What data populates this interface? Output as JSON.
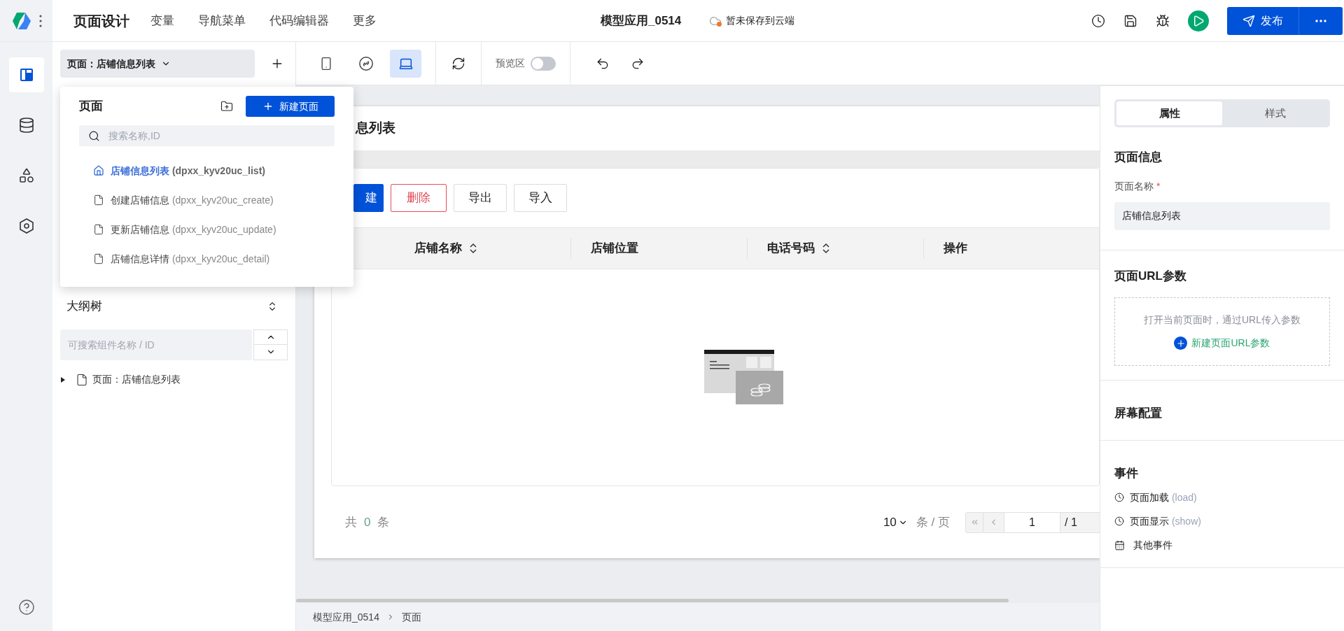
{
  "top_nav": {
    "title": "页面设计",
    "menu": [
      {
        "label": "变量"
      },
      {
        "label": "导航菜单"
      },
      {
        "label": "代码编辑器"
      },
      {
        "label": "更多"
      }
    ]
  },
  "app_title": "模型应用_0514",
  "save_status": "暂未保存到云端",
  "publish_button": "发布",
  "rail": [
    {
      "kind": "layout",
      "selected": true
    },
    {
      "kind": "database",
      "selected": false
    },
    {
      "kind": "components",
      "selected": false
    },
    {
      "kind": "settings",
      "selected": false
    }
  ],
  "page_selector": {
    "label": "页面：店铺信息列表"
  },
  "toolbar": {
    "devices": [
      {
        "kind": "phone",
        "selected": false
      },
      {
        "kind": "link",
        "selected": false
      },
      {
        "kind": "laptop",
        "selected": true
      }
    ],
    "preview": {
      "label": "预览区",
      "on": false
    }
  },
  "pages_dropdown": {
    "title": "页面",
    "new_button": "新建页面",
    "search_placeholder": "搜索名称,ID",
    "pages": [
      {
        "name": "店铺信息列表",
        "id": "(dpxx_kyv20uc_list)",
        "home": true,
        "selected": true
      },
      {
        "name": "创建店铺信息",
        "id": "(dpxx_kyv20uc_create)",
        "home": false,
        "selected": false
      },
      {
        "name": "更新店铺信息",
        "id": "(dpxx_kyv20uc_update)",
        "home": false,
        "selected": false
      },
      {
        "name": "店铺信息详情",
        "id": "(dpxx_kyv20uc_detail)",
        "home": false,
        "selected": false
      }
    ]
  },
  "outline": {
    "title": "大纲树",
    "search_placeholder": "可搜索组件名称 / ID",
    "tree": [
      {
        "label": "页面：店铺信息列表",
        "expanded": false
      }
    ]
  },
  "canvas": {
    "title": "息列表",
    "actions": [
      {
        "label": "建",
        "kind": "primary"
      },
      {
        "label": "删除",
        "kind": "danger"
      },
      {
        "label": "导出",
        "kind": "default"
      },
      {
        "label": "导入",
        "kind": "default"
      }
    ],
    "columns": [
      {
        "label": "店铺名称",
        "sortable": true
      },
      {
        "label": "店铺位置",
        "sortable": false
      },
      {
        "label": "电话号码",
        "sortable": true
      },
      {
        "label": "操作",
        "sortable": false
      }
    ],
    "footer": {
      "total_prefix": "共",
      "total": "0",
      "total_suffix": "条",
      "page_size": "10",
      "page_size_unit": "条 / 页",
      "page": "1",
      "page_total": "/ 1"
    }
  },
  "breadcrumb": [
    "模型应用_0514",
    "页面"
  ],
  "inspector": {
    "tabs": [
      {
        "label": "属性",
        "selected": true
      },
      {
        "label": "样式",
        "selected": false
      }
    ],
    "page_info": {
      "title": "页面信息",
      "field_label": "页面名称",
      "required_mark": "*",
      "value": "店铺信息列表"
    },
    "url_params": {
      "title": "页面URL参数",
      "hint": "打开当前页面时，通过URL传入参数",
      "add_link": "新建页面URL参数"
    },
    "screen_config": {
      "title": "屏幕配置"
    },
    "events": {
      "title": "事件",
      "items": [
        {
          "label": "页面加载",
          "code": "(load)",
          "kind": "lifecycle"
        },
        {
          "label": "页面显示",
          "code": "(show)",
          "kind": "lifecycle"
        },
        {
          "label": "其他事件",
          "kind": "other"
        }
      ]
    }
  }
}
